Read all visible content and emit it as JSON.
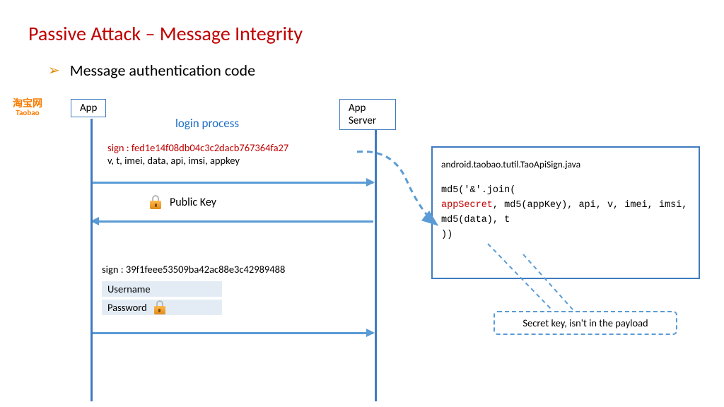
{
  "title": "Passive Attack – Message Integrity",
  "bullet": "Message authentication code",
  "taobao": {
    "zh": "淘宝网",
    "en": "Taobao"
  },
  "seq": {
    "app_label": "App",
    "server_label": "App Server",
    "login_process": "login process",
    "sign1_label": "sign : fed1e14f08db04c3c2dacb767364fa27",
    "sign1_params": "v, t, imei, data, api, imsi, appkey",
    "public_key": "Public Key",
    "sign2": "sign : 39f1feee53509ba42ac88e3c42989488",
    "username": "Username",
    "password": "Password"
  },
  "code": {
    "java_file": "android.taobao.tutil.TaoApiSign.java",
    "line1": "md5('&'.join(",
    "appsecret": "appSecret",
    "params_rest": ", md5(appKey), api, v, imei, imsi, md5(data), t",
    "close": "))"
  },
  "callout": "Secret key, isn't in the payload"
}
